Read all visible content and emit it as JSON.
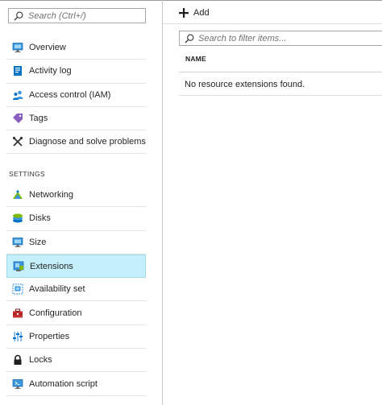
{
  "sidebar": {
    "search_placeholder": "Search (Ctrl+/)",
    "items_top": [
      {
        "label": "Overview",
        "icon": "monitor-icon"
      },
      {
        "label": "Activity log",
        "icon": "activity-log-icon"
      },
      {
        "label": "Access control (IAM)",
        "icon": "users-icon"
      },
      {
        "label": "Tags",
        "icon": "tag-icon"
      },
      {
        "label": "Diagnose and solve problems",
        "icon": "wrench-icon"
      }
    ],
    "section_label": "SETTINGS",
    "items_settings": [
      {
        "label": "Networking",
        "icon": "network-icon"
      },
      {
        "label": "Disks",
        "icon": "disks-icon"
      },
      {
        "label": "Size",
        "icon": "monitor-icon"
      },
      {
        "label": "Extensions",
        "icon": "extensions-icon",
        "active": true
      },
      {
        "label": "Availability set",
        "icon": "availability-set-icon"
      },
      {
        "label": "Configuration",
        "icon": "toolbox-icon"
      },
      {
        "label": "Properties",
        "icon": "sliders-icon"
      },
      {
        "label": "Locks",
        "icon": "lock-icon"
      },
      {
        "label": "Automation script",
        "icon": "automation-icon"
      }
    ]
  },
  "toolbar": {
    "add_label": "Add"
  },
  "main": {
    "filter_placeholder": "Search to filter items...",
    "column_name": "NAME",
    "empty_message": "No resource extensions found."
  },
  "colors": {
    "active_bg": "#c5effa",
    "azure_blue": "#0072c6"
  }
}
